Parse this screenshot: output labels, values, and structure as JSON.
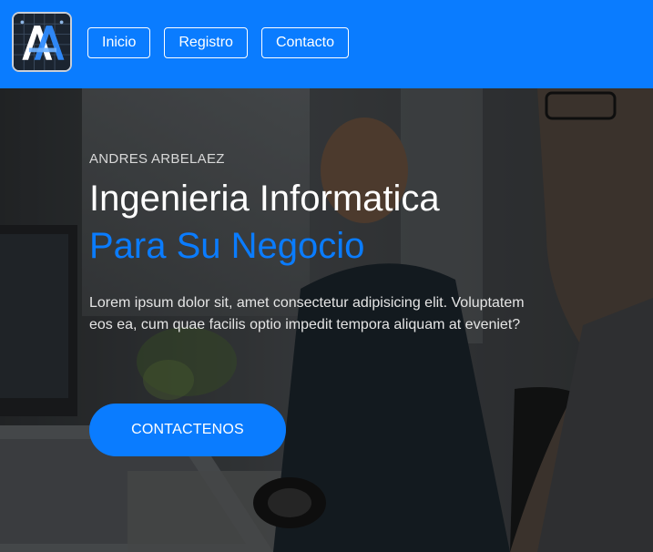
{
  "header": {
    "logo_icon": "aa-logo-icon",
    "nav": [
      {
        "label": "Inicio"
      },
      {
        "label": "Registro"
      },
      {
        "label": "Contacto"
      }
    ],
    "background_color": "#0a7cff"
  },
  "hero": {
    "kicker": "ANDRES ARBELAEZ",
    "title_line1": "Ingenieria Informatica",
    "title_line2": "Para Su Negocio",
    "description": "Lorem ipsum dolor sit, amet consectetur adipisicing elit. Voluptatem eos ea, cum quae facilis optio impedit tempora aliquam at eveniet?",
    "cta_label": "CONTACTENOS",
    "accent_color": "#0a7cff"
  }
}
